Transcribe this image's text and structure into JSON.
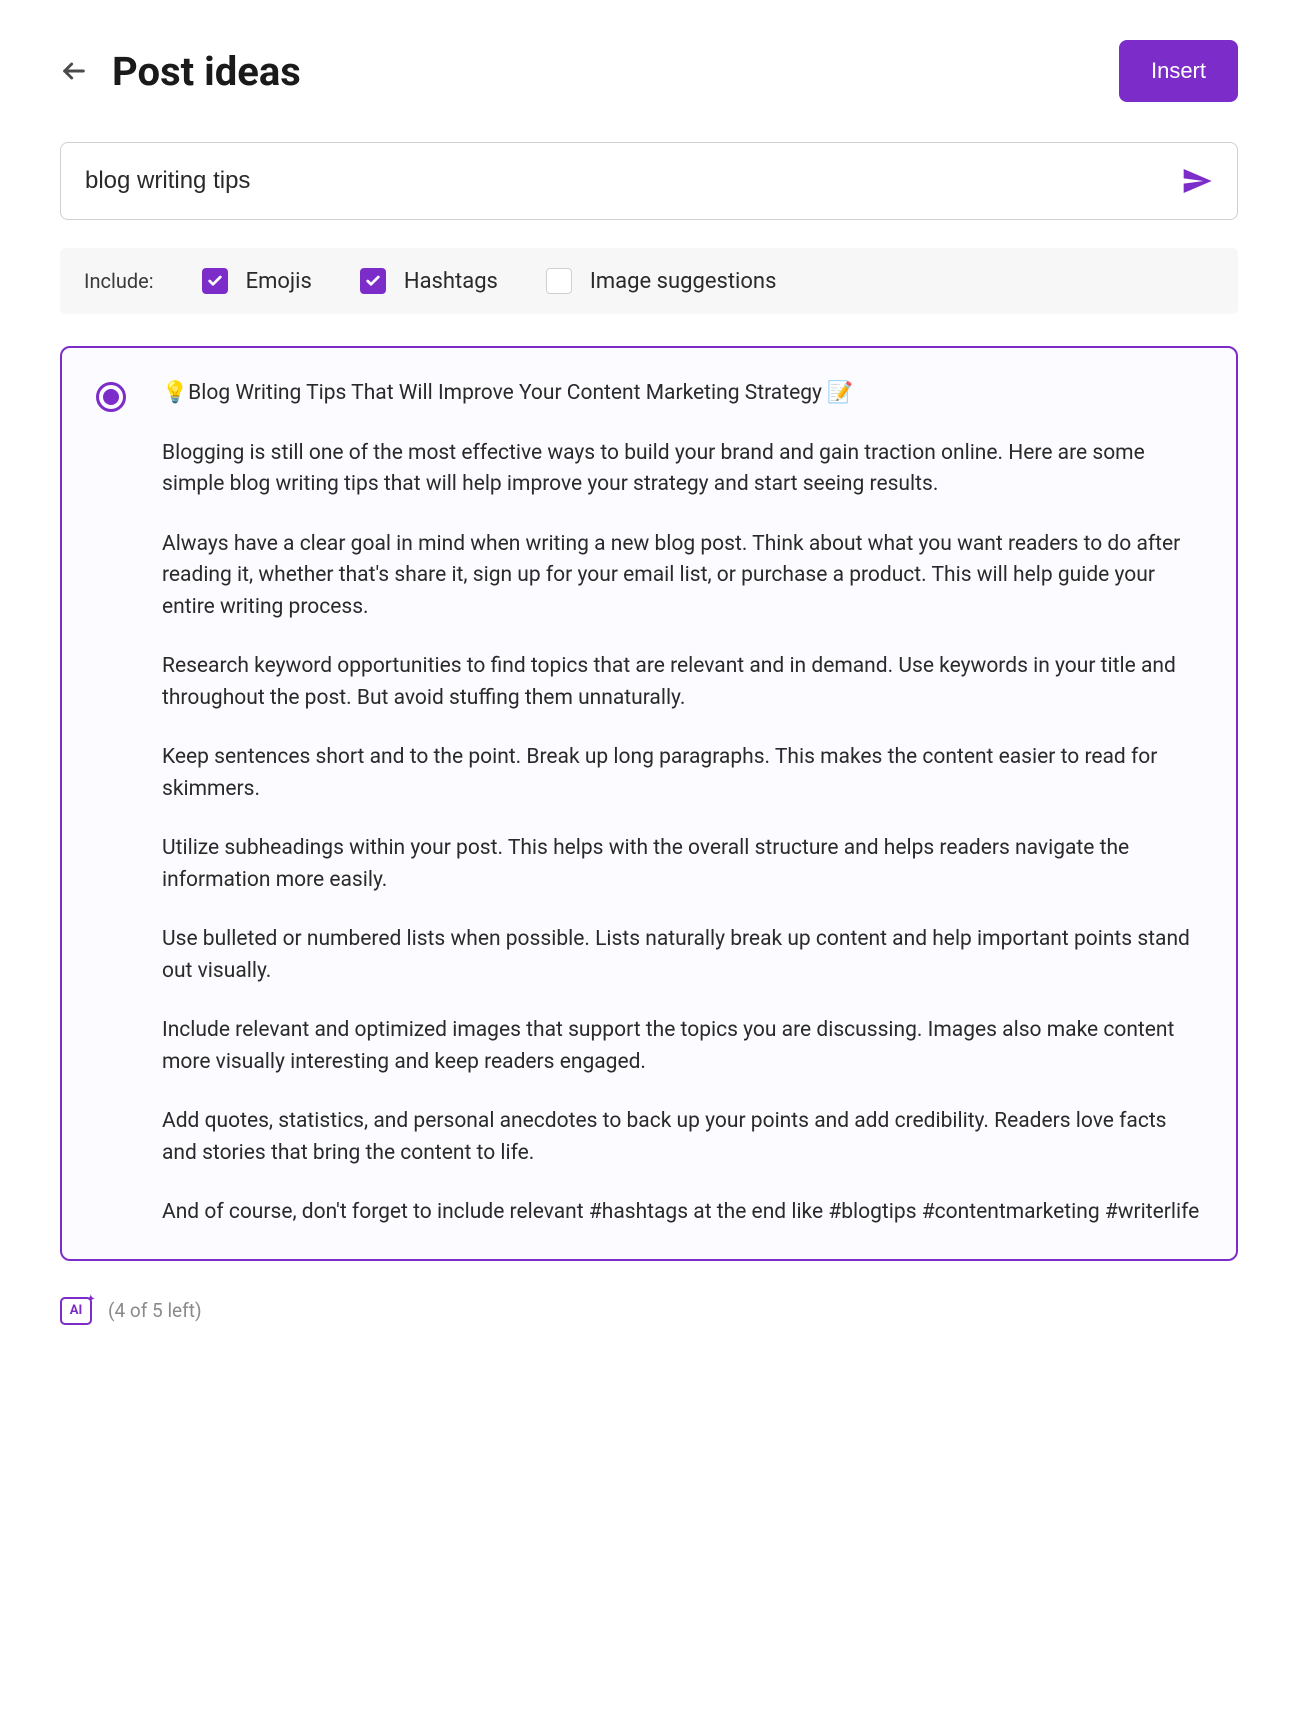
{
  "header": {
    "title": "Post ideas",
    "insert_label": "Insert"
  },
  "search": {
    "value": "blog writing tips"
  },
  "include": {
    "label": "Include:",
    "options": [
      {
        "label": "Emojis",
        "checked": true
      },
      {
        "label": "Hashtags",
        "checked": true
      },
      {
        "label": "Image suggestions",
        "checked": false
      }
    ]
  },
  "result": {
    "selected": true,
    "title": "💡Blog Writing Tips That Will Improve Your Content Marketing Strategy 📝",
    "paragraphs": [
      "Blogging is still one of the most effective ways to build your brand and gain traction online. Here are some simple blog writing tips that will help improve your strategy and start seeing results.",
      "Always have a clear goal in mind when writing a new blog post. Think about what you want readers to do after reading it, whether that's share it, sign up for your email list, or purchase a product. This will help guide your entire writing process.",
      "Research keyword opportunities to find topics that are relevant and in demand. Use keywords in your title and throughout the post. But avoid stuffing them unnaturally.",
      "Keep sentences short and to the point. Break up long paragraphs. This makes the content easier to read for skimmers.",
      "Utilize subheadings within your post. This helps with the overall structure and helps readers navigate the information more easily.",
      "Use bulleted or numbered lists when possible. Lists naturally break up content and help important points stand out visually.",
      "Include relevant and optimized images that support the topics you are discussing. Images also make content more visually interesting and keep readers engaged.",
      "Add quotes, statistics, and personal anecdotes to back up your points and add credibility. Readers love facts and stories that bring the content to life.",
      "And of course, don't forget to include relevant #hashtags at the end like #blogtips #contentmarketing #writerlife"
    ]
  },
  "footer": {
    "ai_label": "AI",
    "usage": "(4 of 5 left)"
  }
}
